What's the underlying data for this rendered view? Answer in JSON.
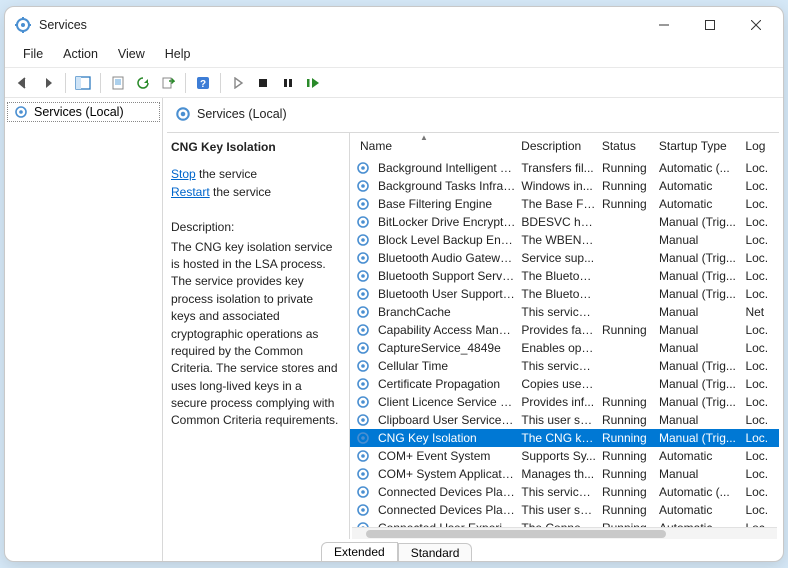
{
  "title": "Services",
  "menus": [
    "File",
    "Action",
    "View",
    "Help"
  ],
  "tree_item": "Services (Local)",
  "right_header": "Services (Local)",
  "selected": {
    "title": "CNG Key Isolation",
    "stop_word": "Stop",
    "stop_rest": " the service",
    "restart_word": "Restart",
    "restart_rest": " the service",
    "desc_label": "Description:",
    "desc_text": "The CNG key isolation service is hosted in the LSA process. The service provides key process isolation to private keys and associated cryptographic operations as required by the Common Criteria. The service stores and uses long-lived keys in a secure process complying with Common Criteria requirements."
  },
  "columns": {
    "name": "Name",
    "desc": "Description",
    "status": "Status",
    "startup": "Startup Type",
    "log": "Log"
  },
  "rows": [
    {
      "name": "Background Intelligent Tran...",
      "desc": "Transfers fil...",
      "status": "Running",
      "startup": "Automatic (...",
      "log": "Loc."
    },
    {
      "name": "Background Tasks Infrastruc...",
      "desc": "Windows in...",
      "status": "Running",
      "startup": "Automatic",
      "log": "Loc."
    },
    {
      "name": "Base Filtering Engine",
      "desc": "The Base Fil...",
      "status": "Running",
      "startup": "Automatic",
      "log": "Loc."
    },
    {
      "name": "BitLocker Drive Encryption ...",
      "desc": "BDESVC hos...",
      "status": "",
      "startup": "Manual (Trig...",
      "log": "Loc."
    },
    {
      "name": "Block Level Backup Engine ...",
      "desc": "The WBENG...",
      "status": "",
      "startup": "Manual",
      "log": "Loc."
    },
    {
      "name": "Bluetooth Audio Gateway S...",
      "desc": "Service sup...",
      "status": "",
      "startup": "Manual (Trig...",
      "log": "Loc."
    },
    {
      "name": "Bluetooth Support Service",
      "desc": "The Bluetoo...",
      "status": "",
      "startup": "Manual (Trig...",
      "log": "Loc."
    },
    {
      "name": "Bluetooth User Support Ser...",
      "desc": "The Bluetoo...",
      "status": "",
      "startup": "Manual (Trig...",
      "log": "Loc."
    },
    {
      "name": "BranchCache",
      "desc": "This service ...",
      "status": "",
      "startup": "Manual",
      "log": "Net"
    },
    {
      "name": "Capability Access Manager ...",
      "desc": "Provides fac...",
      "status": "Running",
      "startup": "Manual",
      "log": "Loc."
    },
    {
      "name": "CaptureService_4849e",
      "desc": "Enables opti...",
      "status": "",
      "startup": "Manual",
      "log": "Loc."
    },
    {
      "name": "Cellular Time",
      "desc": "This service ...",
      "status": "",
      "startup": "Manual (Trig...",
      "log": "Loc."
    },
    {
      "name": "Certificate Propagation",
      "desc": "Copies user ...",
      "status": "",
      "startup": "Manual (Trig...",
      "log": "Loc."
    },
    {
      "name": "Client Licence Service (Clip...",
      "desc": "Provides inf...",
      "status": "Running",
      "startup": "Manual (Trig...",
      "log": "Loc."
    },
    {
      "name": "Clipboard User Service_4849e",
      "desc": "This user ser...",
      "status": "Running",
      "startup": "Manual",
      "log": "Loc."
    },
    {
      "name": "CNG Key Isolation",
      "desc": "The CNG ke...",
      "status": "Running",
      "startup": "Manual (Trig...",
      "log": "Loc.",
      "selected": true
    },
    {
      "name": "COM+ Event System",
      "desc": "Supports Sy...",
      "status": "Running",
      "startup": "Automatic",
      "log": "Loc."
    },
    {
      "name": "COM+ System Application",
      "desc": "Manages th...",
      "status": "Running",
      "startup": "Manual",
      "log": "Loc."
    },
    {
      "name": "Connected Devices Platfor...",
      "desc": "This service ...",
      "status": "Running",
      "startup": "Automatic (...",
      "log": "Loc."
    },
    {
      "name": "Connected Devices Platfor...",
      "desc": "This user ser...",
      "status": "Running",
      "startup": "Automatic",
      "log": "Loc."
    },
    {
      "name": "Connected User Experience...",
      "desc": "The Connec...",
      "status": "Running",
      "startup": "Automatic",
      "log": "Loc."
    }
  ],
  "tabs": {
    "extended": "Extended",
    "standard": "Standard"
  }
}
